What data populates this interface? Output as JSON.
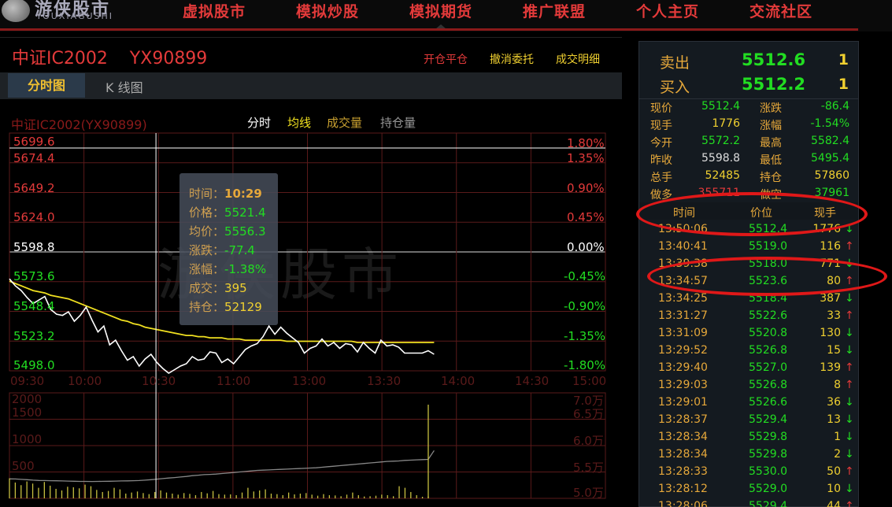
{
  "nav": {
    "logo_cn": "游侠股市",
    "logo_en": "YOUXIAGUSHI",
    "items": [
      "虚拟股市",
      "模拟炒股",
      "模拟期货",
      "推广联盟",
      "个人主页",
      "交流社区"
    ]
  },
  "header": {
    "title": "中证IC2002    YX90899",
    "actions": [
      "开仓平仓",
      "撤消委托",
      "成交明细"
    ]
  },
  "tabs": {
    "fenshi": "分时图",
    "kline": "K 线图"
  },
  "chart": {
    "title": "中证IC2002(YX90899)",
    "legend": [
      "分时",
      "均线",
      "成交量",
      "持仓量"
    ],
    "watermark": "游侠股市",
    "price_labels": [
      "5699.6",
      "5674.4",
      "5649.2",
      "5624.0",
      "5598.8",
      "5573.6",
      "5548.4",
      "5523.2",
      "5498.0"
    ],
    "pct_labels": [
      "1.80%",
      "1.35%",
      "0.90%",
      "0.45%",
      "0.00%",
      "-0.45%",
      "-0.90%",
      "-1.35%",
      "-1.80%"
    ],
    "time_labels": [
      "09:30",
      "10:00",
      "10:30",
      "11:00",
      "13:00",
      "13:30",
      "14:00",
      "14:30",
      "15:00"
    ],
    "vol_labels": [
      "2000",
      "1500",
      "1000",
      "500"
    ],
    "oi_labels": [
      "7.0万",
      "6.5万",
      "6.0万",
      "5.5万",
      "5.0万"
    ]
  },
  "chart_data": {
    "type": "line",
    "prev_close": 5598.8,
    "ylim": [
      5498.0,
      5699.6
    ],
    "x_session": [
      "09:30",
      "15:00"
    ],
    "series": [
      {
        "name": "分时",
        "color": "#ffffff",
        "values": [
          5576,
          5570,
          5566,
          5560,
          5555,
          5558,
          5561,
          5550,
          5546,
          5545,
          5548,
          5540,
          5545,
          5552,
          5541,
          5531,
          5536,
          5520,
          5524,
          5515,
          5507,
          5510,
          5502,
          5508,
          5512,
          5505,
          5500,
          5496,
          5499,
          5502,
          5504,
          5510,
          5507,
          5508,
          5514,
          5513,
          5505,
          5508,
          5504,
          5510,
          5516,
          5519,
          5521,
          5527,
          5536,
          5529,
          5535,
          5530,
          5526,
          5522,
          5513,
          5517,
          5519,
          5525,
          5519,
          5522,
          5517,
          5521,
          5520,
          5514,
          5522,
          5517,
          5513,
          5524,
          5519,
          5520,
          5518,
          5513,
          5513,
          5513,
          5513,
          5515,
          5512
        ]
      },
      {
        "name": "均线",
        "color": "#f0e020",
        "values": [
          5574,
          5572,
          5570,
          5568,
          5566,
          5565,
          5564,
          5562,
          5561,
          5560,
          5559,
          5557,
          5555,
          5553,
          5551,
          5549,
          5547,
          5545,
          5543,
          5541,
          5540,
          5538,
          5537,
          5535,
          5534,
          5533,
          5532,
          5531,
          5530,
          5529,
          5528,
          5528,
          5527,
          5527,
          5526,
          5526,
          5526,
          5525,
          5525,
          5525,
          5524,
          5524,
          5524,
          5524,
          5524,
          5524,
          5524,
          5523,
          5523,
          5523,
          5523,
          5523,
          5523,
          5523,
          5523,
          5523,
          5523,
          5523,
          5523,
          5522,
          5522,
          5522,
          5522,
          5522,
          5522,
          5522,
          5522,
          5522,
          5522,
          5522,
          5522,
          5522,
          5522
        ]
      },
      {
        "name": "成交量",
        "color": "#c8c040",
        "values": [
          380,
          300,
          250,
          320,
          280,
          200,
          310,
          240,
          180,
          150,
          220,
          210,
          190,
          260,
          230,
          160,
          120,
          140,
          200,
          170,
          90,
          110,
          130,
          100,
          80,
          120,
          150,
          110,
          90,
          70,
          100,
          85,
          60,
          120,
          95,
          140,
          80,
          70,
          75,
          60,
          110,
          200,
          130,
          150,
          170,
          90,
          80,
          60,
          110,
          75,
          90,
          100,
          70,
          50,
          80,
          60,
          55,
          40,
          70,
          110,
          60,
          35,
          40,
          50,
          70,
          60,
          40,
          230,
          200,
          120,
          60,
          30,
          40,
          1776
        ]
      },
      {
        "name": "持仓量",
        "color": "#888888",
        "values": [
          52500,
          52480,
          52400,
          52350,
          52250,
          52200,
          52180,
          52150,
          52129,
          52100,
          52080,
          52050,
          52020,
          52010,
          52000,
          52010,
          52030,
          52050,
          52070,
          52100,
          52120,
          52150,
          52180,
          52250,
          52350,
          52450,
          52550,
          52650,
          52750,
          52850,
          52950,
          53100,
          53200,
          53300,
          53350,
          53400,
          53500,
          53600,
          53700,
          53800,
          53900,
          54000,
          54100,
          54150,
          54200,
          54250,
          54300,
          54350,
          54400,
          54450,
          54500,
          54550,
          54600,
          54700,
          54800,
          54900,
          55000,
          55100,
          55200,
          55300,
          55400,
          55500,
          55600,
          55700,
          55800,
          55850,
          55900,
          56000,
          56050,
          56100,
          56150,
          56200,
          57860
        ]
      }
    ],
    "volume_ylim": [
      0,
      2000
    ],
    "oi_ylim": [
      50000,
      70000
    ],
    "grid": true
  },
  "tooltip": {
    "rows": [
      {
        "k": "时间",
        "v": "10:29",
        "color": "#e6a83a"
      },
      {
        "k": "价格",
        "v": "5521.4",
        "color": "#22dd22"
      },
      {
        "k": "均价",
        "v": "5556.3",
        "color": "#22dd22"
      },
      {
        "k": "涨跌",
        "v": "-77.4",
        "color": "#22dd22"
      },
      {
        "k": "涨幅",
        "v": "-1.38%",
        "color": "#22dd22"
      },
      {
        "k": "成交",
        "v": "395",
        "color": "#f0d030"
      },
      {
        "k": "持仓",
        "v": "52129",
        "color": "#f0d030"
      }
    ]
  },
  "orderbook": {
    "sell": {
      "label": "卖出",
      "price": "5512.6",
      "qty": "1"
    },
    "buy": {
      "label": "买入",
      "price": "5512.2",
      "qty": "1"
    }
  },
  "quote": [
    {
      "k1": "现价",
      "v1": "5512.4",
      "c1": "#22dd22",
      "k2": "涨跌",
      "v2": "-86.4",
      "c2": "#22dd22"
    },
    {
      "k1": "现手",
      "v1": "1776",
      "c1": "#f0d030",
      "k2": "涨幅",
      "v2": "-1.54%",
      "c2": "#22dd22"
    },
    {
      "k1": "今开",
      "v1": "5572.2",
      "c1": "#22dd22",
      "k2": "最高",
      "v2": "5582.4",
      "c2": "#22dd22"
    },
    {
      "k1": "昨收",
      "v1": "5598.8",
      "c1": "#dddddd",
      "k2": "最低",
      "v2": "5495.4",
      "c2": "#22dd22"
    },
    {
      "k1": "总手",
      "v1": "52485",
      "c1": "#f0d030",
      "k2": "持仓",
      "v2": "57860",
      "c2": "#f0d030"
    },
    {
      "k1": "做多",
      "v1": "355711",
      "c1": "#e33a3a",
      "k2": "做空",
      "v2": "37961",
      "c2": "#22dd22"
    }
  ],
  "trades_head": [
    "时间",
    "价位",
    "现手"
  ],
  "trades": [
    {
      "time": "13:50:06",
      "price": "5512.4",
      "vol": "1776",
      "dir": "↓"
    },
    {
      "time": "13:40:41",
      "price": "5519.0",
      "vol": "116",
      "dir": "↑"
    },
    {
      "time": "13:39:38",
      "price": "5518.0",
      "vol": "771",
      "dir": "↓"
    },
    {
      "time": "13:34:57",
      "price": "5523.6",
      "vol": "80",
      "dir": "↑"
    },
    {
      "time": "13:34:25",
      "price": "5518.4",
      "vol": "387",
      "dir": "↓"
    },
    {
      "time": "13:31:27",
      "price": "5522.6",
      "vol": "33",
      "dir": "↑"
    },
    {
      "time": "13:31:09",
      "price": "5520.8",
      "vol": "130",
      "dir": "↓"
    },
    {
      "time": "13:29:52",
      "price": "5526.8",
      "vol": "15",
      "dir": "↓"
    },
    {
      "time": "13:29:40",
      "price": "5527.0",
      "vol": "139",
      "dir": "↑"
    },
    {
      "time": "13:29:03",
      "price": "5526.8",
      "vol": "8",
      "dir": "↑"
    },
    {
      "time": "13:29:01",
      "price": "5526.6",
      "vol": "36",
      "dir": "↓"
    },
    {
      "time": "13:28:37",
      "price": "5529.4",
      "vol": "13",
      "dir": "↓"
    },
    {
      "time": "13:28:34",
      "price": "5529.8",
      "vol": "1",
      "dir": "↓"
    },
    {
      "time": "13:28:34",
      "price": "5529.8",
      "vol": "2",
      "dir": "↓"
    },
    {
      "time": "13:28:33",
      "price": "5530.0",
      "vol": "50",
      "dir": "↑"
    },
    {
      "time": "13:28:12",
      "price": "5529.0",
      "vol": "10",
      "dir": "↓"
    },
    {
      "time": "13:28:06",
      "price": "5529.4",
      "vol": "44",
      "dir": "↑"
    }
  ],
  "colors": {
    "up": "#e33a3a",
    "down": "#22dd22",
    "accent": "#f0c030",
    "grid": "#5a1a1a"
  }
}
